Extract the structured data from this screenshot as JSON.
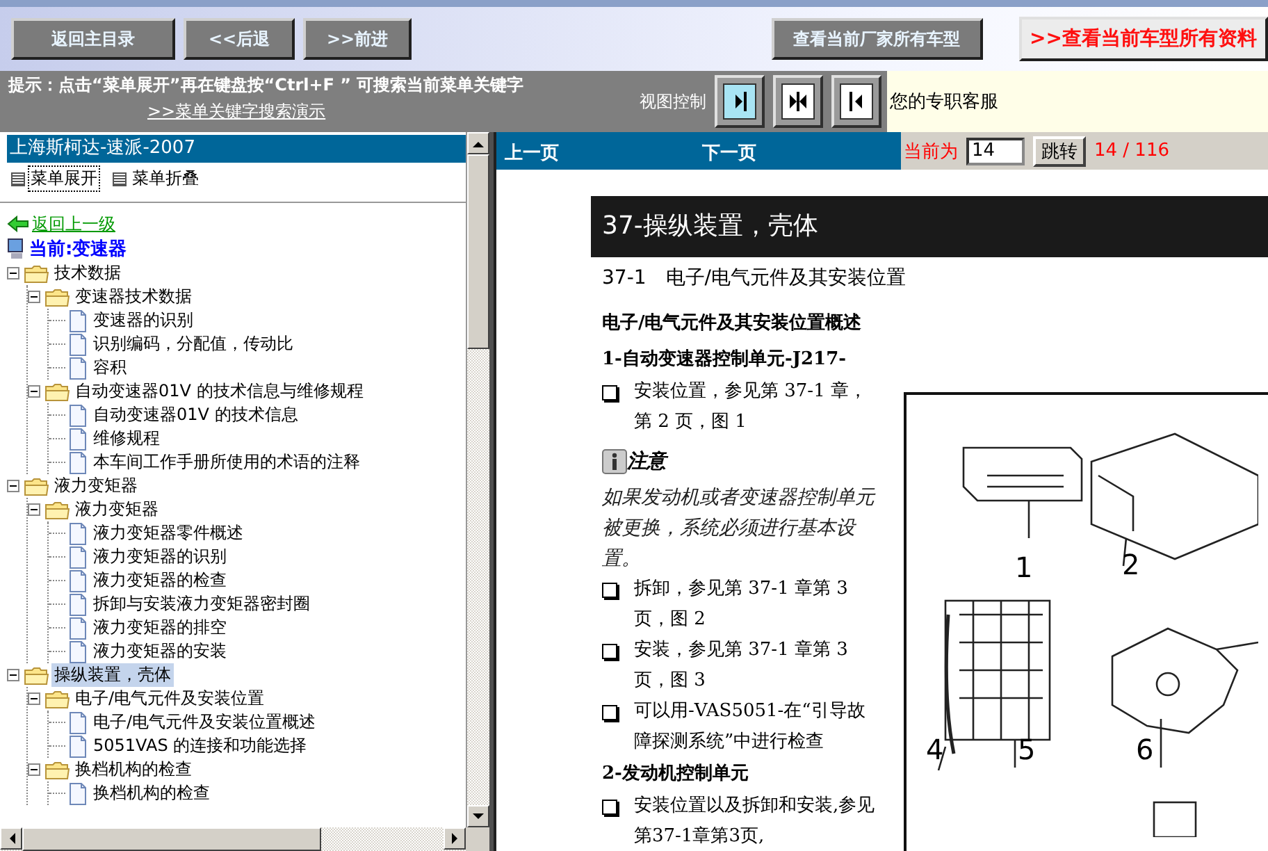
{
  "toolbar": {
    "nav_buttons": [
      "返回主目录",
      "<<后退",
      ">>前进"
    ],
    "maker_button": "查看当前厂家所有车型",
    "model_button": {
      "prefix": ">>",
      "label": "查看当前车型所有资料"
    }
  },
  "hint": {
    "text": "提示：点击“菜单展开”再在键盘按“Ctrl+F ” 可搜索当前菜单关键字",
    "link": ">>菜单关键字搜索演示"
  },
  "view_control": {
    "label": "视图控制",
    "buttons": [
      {
        "kind": "right",
        "selected": true
      },
      {
        "kind": "split",
        "selected": false
      },
      {
        "kind": "left",
        "selected": false
      }
    ]
  },
  "service": {
    "text": "您的专职客服"
  },
  "sidebar": {
    "title": "上海斯柯达-速派-2007",
    "menu_actions": [
      {
        "label": "菜单展开",
        "focused": true
      },
      {
        "label": "菜单折叠",
        "focused": false
      }
    ],
    "back_link": "返回上一级",
    "current": "当前:变速器",
    "tree": [
      {
        "label": "技术数据",
        "kind": "folder",
        "expanded": true,
        "selected": false,
        "children": [
          {
            "label": "变速器技术数据",
            "kind": "folder",
            "expanded": true,
            "selected": false,
            "children": [
              {
                "label": "变速器的识别",
                "kind": "page",
                "selected": false
              },
              {
                "label": "识别编码，分配值，传动比",
                "kind": "page",
                "selected": false
              },
              {
                "label": "容积",
                "kind": "page",
                "selected": false
              }
            ]
          },
          {
            "label": "自动变速器01V 的技术信息与维修规程",
            "kind": "folder",
            "expanded": true,
            "selected": false,
            "children": [
              {
                "label": "自动变速器01V 的技术信息",
                "kind": "page",
                "selected": false
              },
              {
                "label": "维修规程",
                "kind": "page",
                "selected": false
              },
              {
                "label": "本车间工作手册所使用的术语的注释",
                "kind": "page",
                "selected": false
              }
            ]
          }
        ]
      },
      {
        "label": "液力变矩器",
        "kind": "folder",
        "expanded": true,
        "selected": false,
        "children": [
          {
            "label": "液力变矩器",
            "kind": "folder",
            "expanded": true,
            "selected": false,
            "children": [
              {
                "label": "液力变矩器零件概述",
                "kind": "page",
                "selected": false
              },
              {
                "label": "液力变矩器的识别",
                "kind": "page",
                "selected": false
              },
              {
                "label": "液力变矩器的检查",
                "kind": "page",
                "selected": false
              },
              {
                "label": "拆卸与安装液力变矩器密封圈",
                "kind": "page",
                "selected": false
              },
              {
                "label": "液力变矩器的排空",
                "kind": "page",
                "selected": false
              },
              {
                "label": "液力变矩器的安装",
                "kind": "page",
                "selected": false
              }
            ]
          }
        ]
      },
      {
        "label": "操纵装置，壳体",
        "kind": "folder",
        "expanded": true,
        "selected": true,
        "children": [
          {
            "label": "电子/电气元件及安装位置",
            "kind": "folder",
            "expanded": true,
            "selected": false,
            "children": [
              {
                "label": "电子/电气元件及安装位置概述",
                "kind": "page",
                "selected": false
              },
              {
                "label": "5051VAS 的连接和功能选择",
                "kind": "page",
                "selected": false
              }
            ]
          },
          {
            "label": "换档机构的检查",
            "kind": "folder",
            "expanded": true,
            "selected": false,
            "children": [
              {
                "label": "换档机构的检查",
                "kind": "page",
                "selected": false
              }
            ]
          }
        ]
      }
    ]
  },
  "pager": {
    "prev": "上一页",
    "next": "下一页",
    "current_label": "当前为",
    "page_value": "14",
    "go_button": "跳转",
    "page_count": "14 / 116"
  },
  "document": {
    "title": "37-操纵装置，壳体",
    "section": "37-1　电子/电气元件及其安装位置",
    "overview": "电子/电气元件及其安装位置概述",
    "blocks": [
      {
        "kind": "item-title",
        "text": "1-自动变速器控制单元-J217-"
      },
      {
        "kind": "bullet",
        "text": "安装位置，参见第 37-1 章，第 2 页，图 1"
      },
      {
        "kind": "note-title",
        "text": "注意"
      },
      {
        "kind": "note-text",
        "text": "如果发动机或者变速器控制单元被更换，系统必须进行基本设置。"
      },
      {
        "kind": "bullet",
        "text": "拆卸，参见第 37-1 章第 3 页，图 2"
      },
      {
        "kind": "bullet",
        "text": "安装，参见第 37-1 章第 3 页，图 3"
      },
      {
        "kind": "bullet",
        "text": "可以用-VAS5051-在“引导故障探测系统”中进行检查"
      },
      {
        "kind": "item-title",
        "text": "2-发动机控制单元"
      },
      {
        "kind": "bullet",
        "text": "安装位置以及拆卸和安装,参见第37-1章第3页,"
      }
    ],
    "figure": {
      "callouts": [
        "1",
        "2",
        "4",
        "5",
        "6"
      ]
    }
  }
}
